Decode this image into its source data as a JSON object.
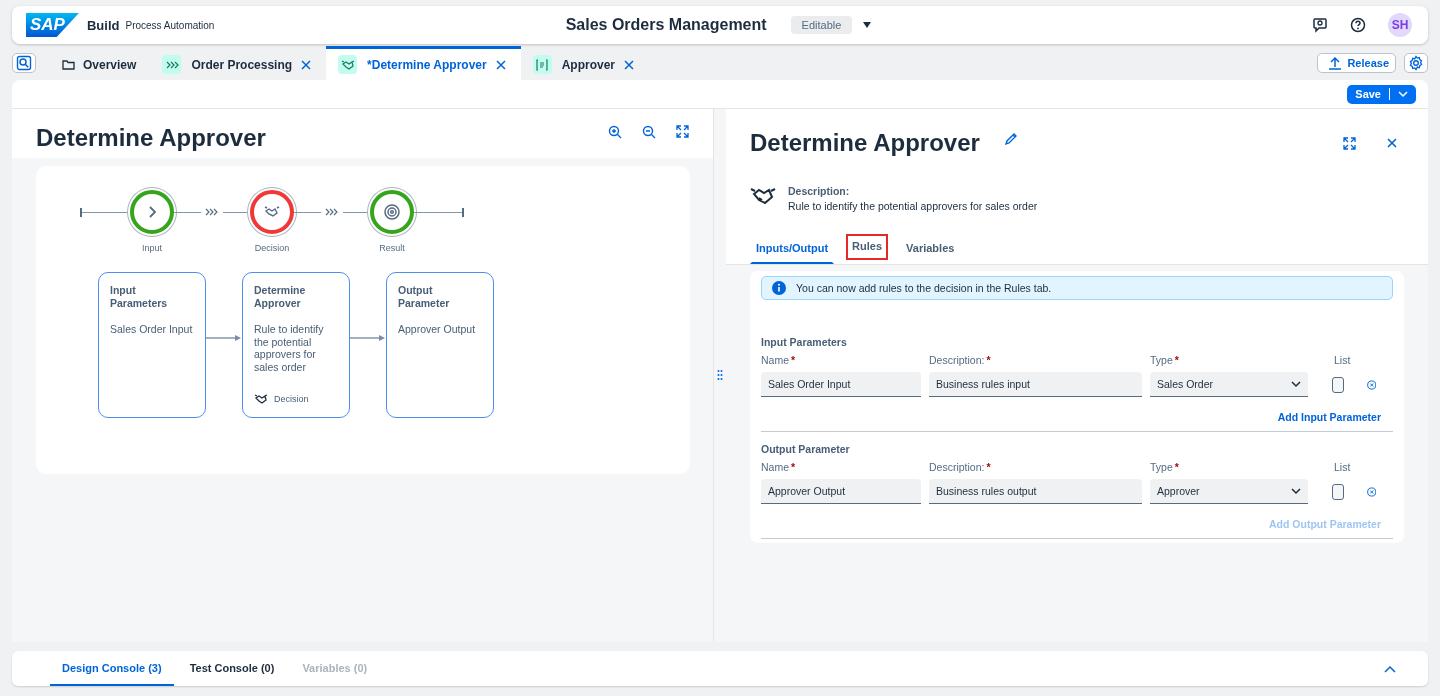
{
  "shell": {
    "logo": "SAP",
    "product": "Build",
    "subtitle": "Process Automation",
    "title": "Sales Orders Management",
    "status": "Editable",
    "avatar": "SH"
  },
  "tabs": [
    {
      "label": "Overview",
      "kind": "folder",
      "selected": false,
      "closable": false
    },
    {
      "label": "Order Processing",
      "kind": "process",
      "selected": false,
      "closable": true
    },
    {
      "label": "*Determine Approver",
      "kind": "decision",
      "selected": true,
      "closable": true
    },
    {
      "label": "Approver",
      "kind": "object",
      "selected": false,
      "closable": true
    }
  ],
  "toolbar": {
    "release": "Release",
    "save": "Save"
  },
  "canvas": {
    "title": "Determine Approver",
    "steps": [
      {
        "label": "Input",
        "kind": "input",
        "color": "#36a41d"
      },
      {
        "label": "Decision",
        "kind": "decision",
        "color": "#ee3939"
      },
      {
        "label": "Result",
        "kind": "result",
        "color": "#36a41d"
      }
    ],
    "cards": [
      {
        "title": "Input Parameters",
        "text": "Sales Order Input"
      },
      {
        "title": "Determine Approver",
        "text": "Rule to identify the potential approvers for sales order",
        "footer": "Decision"
      },
      {
        "title": "Output Parameter",
        "text": "Approver Output"
      }
    ]
  },
  "panel": {
    "title": "Determine Approver",
    "description_label": "Description:",
    "description": "Rule to identify the potential approvers for sales order",
    "tabs": [
      {
        "label": "Inputs/Output",
        "selected": true,
        "highlighted": false
      },
      {
        "label": "Rules",
        "selected": false,
        "highlighted": true
      },
      {
        "label": "Variables",
        "selected": false,
        "highlighted": false
      }
    ],
    "info": "You can now add rules to the decision in the Rules tab.",
    "sections": [
      {
        "title": "Input Parameters",
        "headers": [
          {
            "label": "Name",
            "mark": "*"
          },
          {
            "label": "Description:",
            "mark": "*"
          },
          {
            "label": "Type",
            "mark": "*"
          },
          {
            "label": "List"
          }
        ],
        "row": {
          "name": "Sales Order Input",
          "description": "Business rules input",
          "type": "Sales Order",
          "list_checked": false
        },
        "add": {
          "label": "Add Input Parameter",
          "disabled": false
        }
      },
      {
        "title": "Output Parameter",
        "headers": [
          {
            "label": "Name",
            "mark": "*"
          },
          {
            "label": "Description:",
            "mark": "*"
          },
          {
            "label": "Type",
            "mark": "*"
          },
          {
            "label": "List"
          }
        ],
        "row": {
          "name": "Approver Output",
          "description": "Business rules output",
          "type": "Approver",
          "list_checked": false
        },
        "add": {
          "label": "Add Output Parameter",
          "disabled": true
        }
      }
    ]
  },
  "console": {
    "tabs": [
      {
        "label": "Design Console (3)",
        "selected": true,
        "disabled": false
      },
      {
        "label": "Test Console (0)",
        "selected": false,
        "disabled": false
      },
      {
        "label": "Variables (0)",
        "selected": false,
        "disabled": true
      }
    ]
  }
}
